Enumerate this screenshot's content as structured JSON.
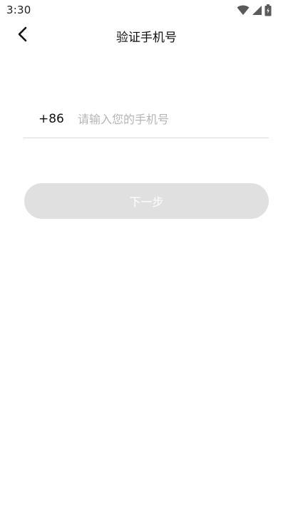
{
  "status_bar": {
    "time": "3:30",
    "icons": [
      "wifi-icon",
      "cellular-signal-icon",
      "battery-icon"
    ]
  },
  "header": {
    "title": "验证手机号",
    "back_icon": "chevron-left-icon"
  },
  "phone_form": {
    "country_code": "+86",
    "phone_value": "",
    "phone_placeholder": "请输入您的手机号"
  },
  "actions": {
    "next_label": "下一步"
  },
  "colors": {
    "background": "#ffffff",
    "text": "#111111",
    "placeholder": "#b5b5b5",
    "divider": "#dcdcdc",
    "button_disabled_bg": "#e0e0e0",
    "button_text": "#ffffff"
  }
}
